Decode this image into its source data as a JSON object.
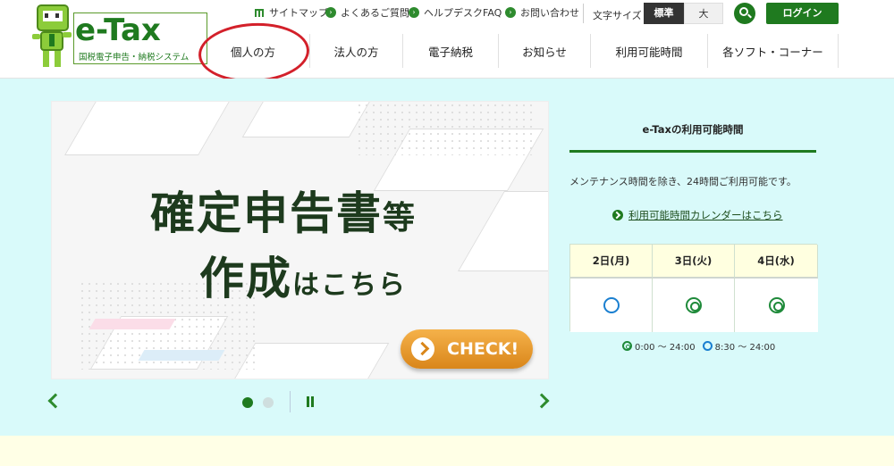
{
  "logo": {
    "title": "e-Tax",
    "subtitle": "国税電子申告・納税システム"
  },
  "utility": [
    {
      "label": "サイトマップ",
      "icon": "sitemap-icon"
    },
    {
      "label": "よくあるご質問",
      "icon": "circle-arrow-icon"
    },
    {
      "label": "ヘルプデスクFAQ",
      "icon": "circle-arrow-icon"
    },
    {
      "label": "お問い合わせ",
      "icon": "circle-arrow-icon"
    }
  ],
  "font_size": {
    "label": "文字サイズ",
    "standard": "標準",
    "large": "大"
  },
  "login": "ログイン",
  "nav": [
    "個人の方",
    "法人の方",
    "電子納税",
    "お知らせ",
    "利用可能時間",
    "各ソフト・コーナー"
  ],
  "banner": {
    "line1": "確定申告書",
    "line1_small": "等",
    "line2": "作成",
    "line2_small": "はこちら",
    "button": "CHECK!"
  },
  "panel": {
    "title": "e-Taxの利用可能時間",
    "description": "メンテナンス時間を除き、24時間ご利用可能です。",
    "calendar_link": "利用可能時間カレンダーはこちら",
    "days": [
      "2日(月)",
      "3日(火)",
      "4日(水)"
    ],
    "legend_double": "0:00 ～ 24:00",
    "legend_ring": "8:30 ～ 24:00"
  },
  "colors": {
    "brand_green": "#1f7a1f",
    "main_bg": "#d9fafa",
    "check_orange": "#e8982a",
    "annotation_red": "#d3202a"
  }
}
